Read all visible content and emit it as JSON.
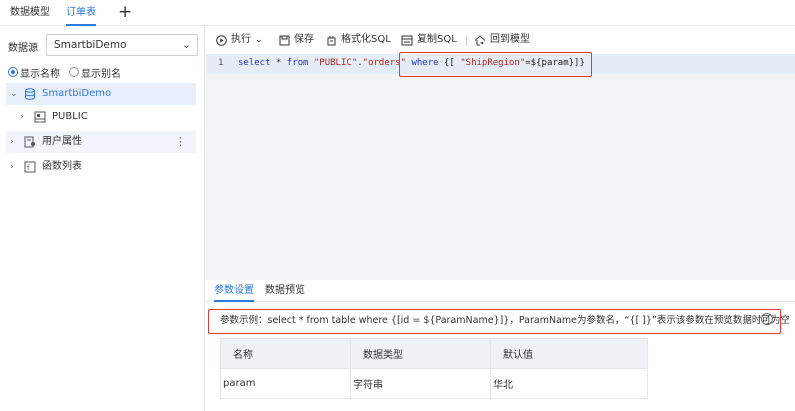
{
  "top_tabs": [
    {
      "label": "数据模型",
      "active": false
    },
    {
      "label": "订单表",
      "active": true
    }
  ],
  "add_tab_symbol": "+",
  "datasource": {
    "label": "数据源",
    "selected": "SmartbiDemo"
  },
  "display_options": [
    {
      "label": "显示名称",
      "checked": true
    },
    {
      "label": "显示别名",
      "checked": false
    }
  ],
  "tree": [
    {
      "label": "SmartbiDemo",
      "icon": "database-icon",
      "expanded": true,
      "selected": true
    },
    {
      "label": "PUBLIC",
      "icon": "schema-icon",
      "expanded": false
    },
    {
      "label": "用户属性",
      "icon": "user-attribute-icon",
      "expanded": false
    },
    {
      "label": "函数列表",
      "icon": "function-icon",
      "expanded": false
    }
  ],
  "toolbar": {
    "execute_label": "执行",
    "save_label": "保存",
    "format_label": "格式化SQL",
    "copy_label": "复制SQL",
    "back_label": "回到模型"
  },
  "editor": {
    "line_number": "1",
    "sql_prefix_kw1": "select",
    "sql_star_from": " * ",
    "sql_from": "from",
    "sql_schema": " \"PUBLIC\"",
    "sql_dot": ".",
    "sql_table": "\"orders\"",
    "sql_where": " where",
    "sql_brace_open": " {[ ",
    "sql_field": "\"ShipRegion\"",
    "sql_param": "=${param}]}"
  },
  "bottom_tabs": [
    {
      "label": "参数设置",
      "active": true
    },
    {
      "label": "数据预览",
      "active": false
    }
  ],
  "hint_text": "参数示例：select * from table where {[id = ${ParamName}]}，ParamName为参数名，“{[ ]}”表示该参数在预览数据时可为空",
  "param_table": {
    "headers": [
      "名称",
      "数据类型",
      "默认值"
    ],
    "rows": [
      [
        "param",
        "字符串",
        "华北"
      ]
    ]
  },
  "colors": {
    "accent": "#2c7be5",
    "highlight_border": "#e53935",
    "keyword": "#1f35c9",
    "string": "#b3261e"
  }
}
